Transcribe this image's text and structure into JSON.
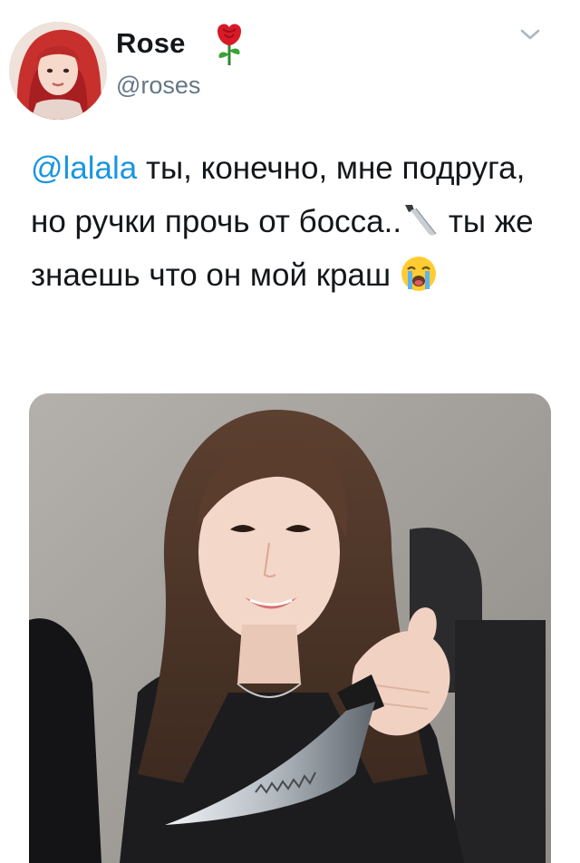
{
  "author": {
    "display_name": "Rose",
    "handle": "@roses",
    "name_emoji": "rose-emoji"
  },
  "tweet": {
    "mention": "@lalala",
    "text_part1": " ты, конечно, мне подруга, но ручки прочь от босса..",
    "emoji1": "knife-emoji",
    "text_part2": " ты же знаешь что он мой краш",
    "emoji2": "loudly-crying-face-emoji"
  },
  "media": {
    "icon": "photo-girl-holding-knife"
  },
  "colors": {
    "text": "#14171a",
    "secondary": "#657786",
    "link": "#1b95e0"
  }
}
